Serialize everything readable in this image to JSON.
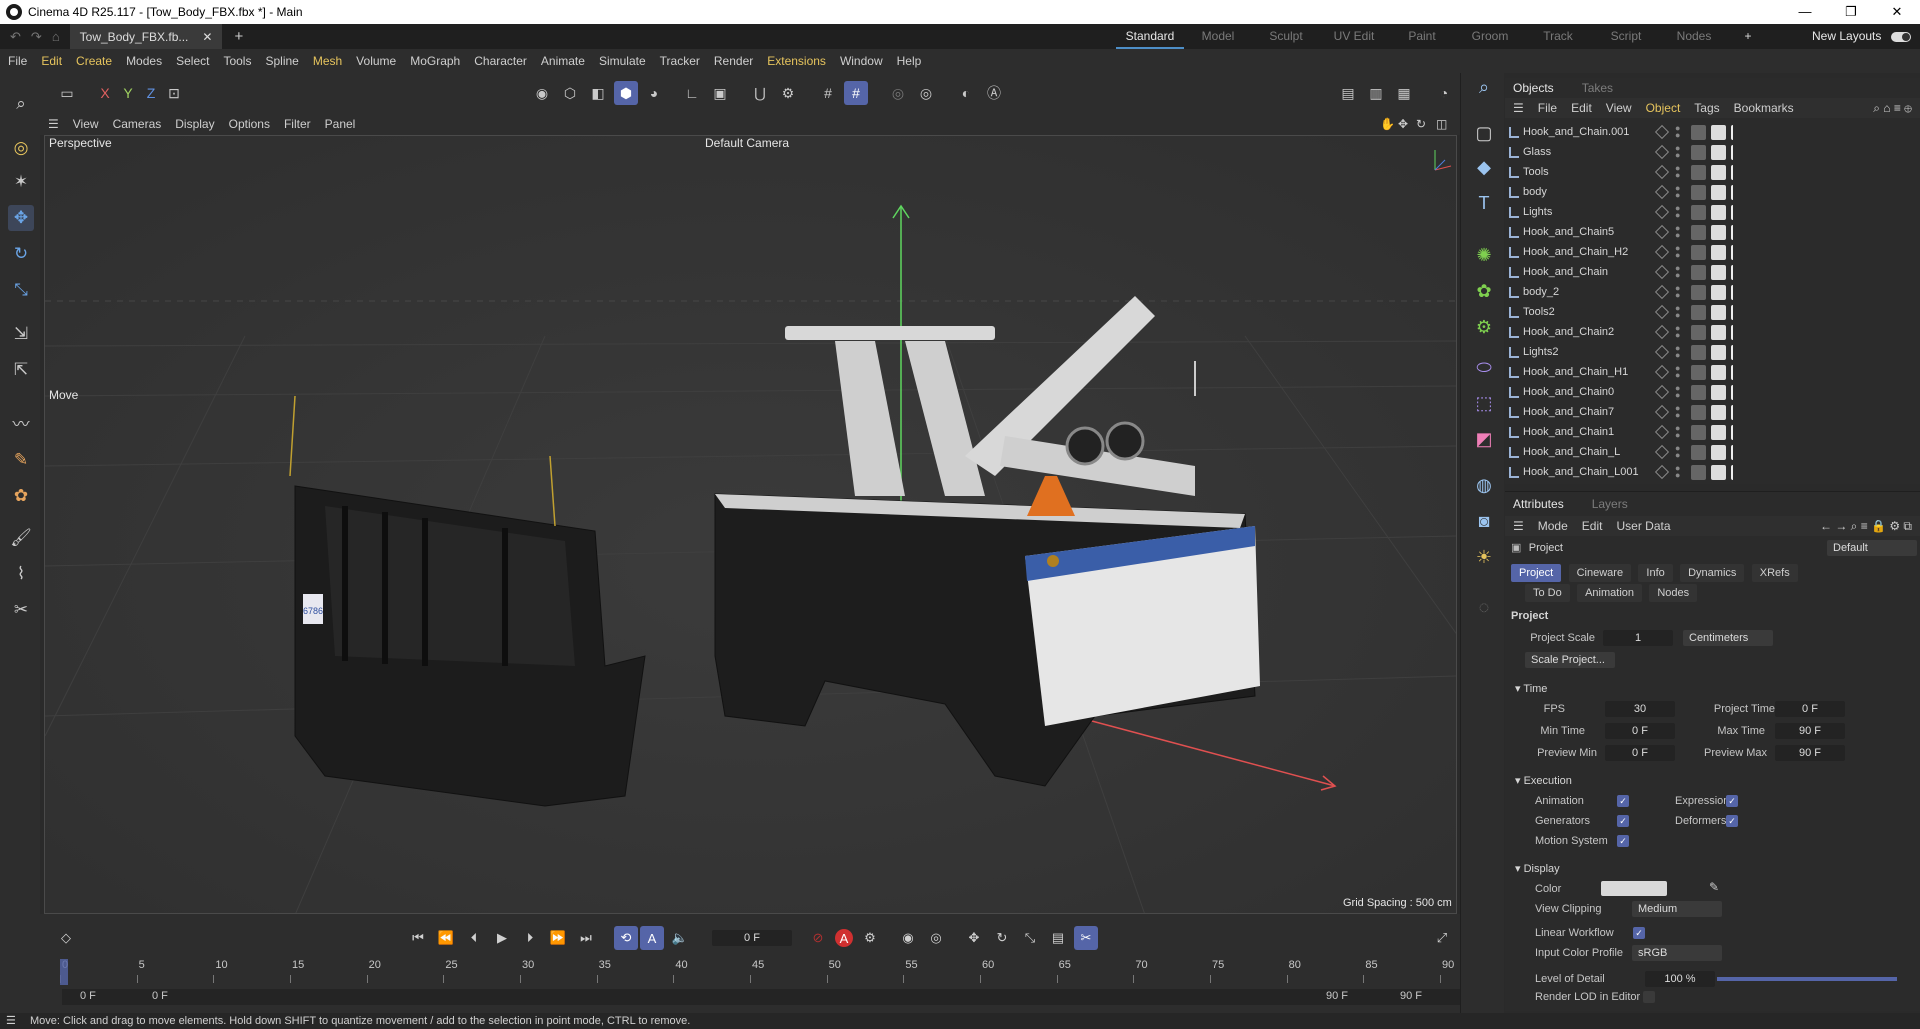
{
  "window": {
    "title": "Cinema 4D R25.117 - [Tow_Body_FBX.fbx *] - Main",
    "controls": [
      "—",
      "❐",
      "✕"
    ]
  },
  "doc_tab": {
    "label": "Tow_Body_FBX.fb...",
    "close": "✕",
    "new": "+"
  },
  "layouts": [
    "Standard",
    "Model",
    "Sculpt",
    "UV Edit",
    "Paint",
    "Groom",
    "Track",
    "Script",
    "Nodes"
  ],
  "layouts_plus": "+",
  "new_layouts": "New Layouts",
  "menu": [
    "File",
    "Edit",
    "Create",
    "Modes",
    "Select",
    "Tools",
    "Spline",
    "Mesh",
    "Volume",
    "MoGraph",
    "Character",
    "Animate",
    "Simulate",
    "Tracker",
    "Render",
    "Extensions",
    "Window",
    "Help"
  ],
  "axes": {
    "x": "X",
    "y": "Y",
    "z": "Z"
  },
  "viewport_menu": [
    "View",
    "Cameras",
    "Display",
    "Options",
    "Filter",
    "Panel"
  ],
  "viewport": {
    "projection": "Perspective",
    "camera": "Default Camera",
    "tool_label": "Move",
    "grid_spacing": "Grid Spacing : 500 cm",
    "plate_text": "6786"
  },
  "objects_panel": {
    "tabs": [
      "Objects",
      "Takes"
    ],
    "menu": [
      "File",
      "Edit",
      "View",
      "Object",
      "Tags",
      "Bookmarks"
    ],
    "objects": [
      "Hook_and_Chain.001",
      "Glass",
      "Tools",
      "body",
      "Lights",
      "Hook_and_Chain5",
      "Hook_and_Chain_H2",
      "Hook_and_Chain",
      "body_2",
      "Tools2",
      "Hook_and_Chain2",
      "Lights2",
      "Hook_and_Chain_H1",
      "Hook_and_Chain0",
      "Hook_and_Chain7",
      "Hook_and_Chain1",
      "Hook_and_Chain_L",
      "Hook_and_Chain_L001"
    ]
  },
  "attributes_panel": {
    "tabs": [
      "Attributes",
      "Layers"
    ],
    "menu": [
      "Mode",
      "Edit",
      "User Data"
    ],
    "object_label": "Project",
    "preset": "Default",
    "subtabs_row1": [
      "Project",
      "Cineware",
      "Info",
      "Dynamics",
      "XRefs"
    ],
    "subtabs_row2": [
      "To Do",
      "Animation",
      "Nodes"
    ],
    "section_title": "Project",
    "project_scale_label": "Project Scale",
    "project_scale_value": "1",
    "project_scale_unit": "Centimeters",
    "scale_button": "Scale Project...",
    "time": {
      "header": "Time",
      "fps_label": "FPS",
      "fps": "30",
      "project_time_label": "Project Time",
      "project_time": "0 F",
      "min_time_label": "Min Time",
      "min_time": "0 F",
      "max_time_label": "Max Time",
      "max_time": "90 F",
      "preview_min_label": "Preview Min",
      "preview_min": "0 F",
      "preview_max_label": "Preview Max",
      "preview_max": "90 F"
    },
    "execution": {
      "header": "Execution",
      "animation": "Animation",
      "expression": "Expression",
      "generators": "Generators",
      "deformers": "Deformers",
      "motion_system": "Motion System"
    },
    "display": {
      "header": "Display",
      "color_label": "Color",
      "color_value": "#d9d9d9",
      "view_clipping_label": "View Clipping",
      "view_clipping": "Medium",
      "linear_workflow_label": "Linear Workflow",
      "input_color_profile_label": "Input Color Profile",
      "input_color_profile": "sRGB",
      "level_of_detail_label": "Level of Detail",
      "level_of_detail": "100 %",
      "level_of_detail_fraction": 1.0,
      "render_lod_label": "Render LOD in Editor"
    }
  },
  "timeline": {
    "current_frame": "0 F",
    "start_left": "0 F",
    "start_right": "0 F",
    "end_left": "90 F",
    "end_right": "90 F",
    "ticks": [
      "0",
      "5",
      "10",
      "15",
      "20",
      "25",
      "30",
      "35",
      "40",
      "45",
      "50",
      "55",
      "60",
      "65",
      "70",
      "75",
      "80",
      "85",
      "90"
    ]
  },
  "status": "Move: Click and drag to move elements. Hold down SHIFT to quantize movement / add to the selection in point mode, CTRL to remove.",
  "colors": {
    "accent": "#5565a8",
    "accent_blue": "#4d8ec7",
    "highlight_menu": "#e6c45d"
  }
}
